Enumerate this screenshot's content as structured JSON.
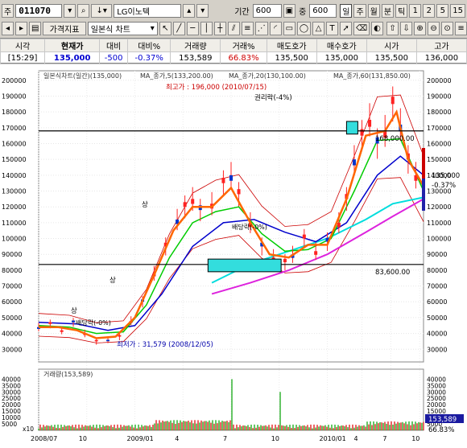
{
  "toolbar": {
    "market_label": "주",
    "code": "011070",
    "name": "LG이노텍",
    "period_label": "기간",
    "period_value": "600",
    "count_label": "중",
    "count_value": "600",
    "period_buttons": [
      "일",
      "주",
      "월",
      "분",
      "틱",
      "1",
      "2",
      "5",
      "15"
    ],
    "selected_period": "일",
    "indicator_button": "가격지표",
    "chart_type": "일본식 차트",
    "arrows": [
      "↑",
      "↓",
      "→"
    ]
  },
  "quote": {
    "headers": [
      "시각",
      "현재가",
      "대비",
      "대비%",
      "거래량",
      "거래%",
      "매도호가",
      "매수호가",
      "시가",
      "고가"
    ],
    "values": [
      "[15:29]",
      "135,000",
      "-500",
      "-0.37%",
      "153,589",
      "66.83%",
      "135,500",
      "135,000",
      "135,500",
      "136,000"
    ]
  },
  "colors": {
    "ma5": "#ff6600",
    "ma20": "#00cc00",
    "ma60": "#0000cc",
    "ma120": "#00dddd",
    "ma240": "#dd22dd",
    "bollinger": "#cc0000",
    "candle": "#ff2222",
    "volume_up": "#dd0000",
    "volume_down": "#00a000",
    "highlight": "#33dddd"
  },
  "chart_data": {
    "type": "line",
    "price_legend": "일본식차트(일간)(135,000)",
    "ma5_legend": "MA_종가,5(133,200.00)",
    "ma20_legend": "MA_종가,20(130,100.00)",
    "ma60_legend": "MA_종가,60(131,850.00)",
    "y_ticks": [
      30000,
      40000,
      50000,
      60000,
      70000,
      80000,
      90000,
      100000,
      110000,
      120000,
      130000,
      140000,
      150000,
      160000,
      170000,
      180000,
      190000,
      200000
    ],
    "ylim": [
      22000,
      206000
    ],
    "x_ticks": [
      "2008/07",
      "10",
      "2009/01",
      "4",
      "7",
      "10",
      "2010/01",
      "4",
      "7",
      "10"
    ],
    "x_tick_pos": [
      0,
      0.125,
      0.25,
      0.375,
      0.5,
      0.625,
      0.75,
      0.84,
      0.915,
      0.99
    ],
    "price_series": [
      [
        0,
        44000
      ],
      [
        0.03,
        46000
      ],
      [
        0.06,
        42000
      ],
      [
        0.09,
        47000
      ],
      [
        0.12,
        40000
      ],
      [
        0.15,
        35000
      ],
      [
        0.18,
        36000
      ],
      [
        0.21,
        38000
      ],
      [
        0.24,
        48000
      ],
      [
        0.27,
        60000
      ],
      [
        0.3,
        78000
      ],
      [
        0.33,
        95000
      ],
      [
        0.36,
        112000
      ],
      [
        0.38,
        120000
      ],
      [
        0.4,
        125000
      ],
      [
        0.42,
        118000
      ],
      [
        0.45,
        122000
      ],
      [
        0.48,
        135000
      ],
      [
        0.5,
        140000
      ],
      [
        0.52,
        128000
      ],
      [
        0.55,
        110000
      ],
      [
        0.58,
        95000
      ],
      [
        0.61,
        88000
      ],
      [
        0.64,
        85000
      ],
      [
        0.66,
        90000
      ],
      [
        0.69,
        100000
      ],
      [
        0.72,
        92000
      ],
      [
        0.75,
        98000
      ],
      [
        0.78,
        110000
      ],
      [
        0.8,
        125000
      ],
      [
        0.82,
        150000
      ],
      [
        0.84,
        165000
      ],
      [
        0.86,
        175000
      ],
      [
        0.88,
        160000
      ],
      [
        0.9,
        168000
      ],
      [
        0.92,
        185000
      ],
      [
        0.94,
        172000
      ],
      [
        0.96,
        150000
      ],
      [
        0.98,
        140000
      ],
      [
        1.0,
        132000
      ]
    ],
    "ma5": [
      [
        0,
        44000
      ],
      [
        0.05,
        44000
      ],
      [
        0.1,
        42000
      ],
      [
        0.15,
        37000
      ],
      [
        0.2,
        38000
      ],
      [
        0.25,
        50000
      ],
      [
        0.3,
        77000
      ],
      [
        0.35,
        105000
      ],
      [
        0.4,
        120000
      ],
      [
        0.45,
        120000
      ],
      [
        0.5,
        132000
      ],
      [
        0.55,
        110000
      ],
      [
        0.6,
        90000
      ],
      [
        0.65,
        88000
      ],
      [
        0.7,
        96000
      ],
      [
        0.75,
        96000
      ],
      [
        0.8,
        125000
      ],
      [
        0.85,
        165000
      ],
      [
        0.9,
        168000
      ],
      [
        0.93,
        180000
      ],
      [
        0.96,
        150000
      ],
      [
        1.0,
        133200
      ]
    ],
    "ma20": [
      [
        0,
        45000
      ],
      [
        0.08,
        44000
      ],
      [
        0.15,
        40000
      ],
      [
        0.22,
        41000
      ],
      [
        0.28,
        58000
      ],
      [
        0.34,
        88000
      ],
      [
        0.4,
        110000
      ],
      [
        0.46,
        117000
      ],
      [
        0.52,
        120000
      ],
      [
        0.58,
        103000
      ],
      [
        0.64,
        92000
      ],
      [
        0.7,
        93000
      ],
      [
        0.76,
        100000
      ],
      [
        0.82,
        130000
      ],
      [
        0.88,
        162000
      ],
      [
        0.94,
        163000
      ],
      [
        1.0,
        130100
      ]
    ],
    "ma60": [
      [
        0,
        47000
      ],
      [
        0.1,
        46000
      ],
      [
        0.18,
        42000
      ],
      [
        0.25,
        45000
      ],
      [
        0.32,
        65000
      ],
      [
        0.4,
        95000
      ],
      [
        0.48,
        110000
      ],
      [
        0.56,
        112000
      ],
      [
        0.64,
        104000
      ],
      [
        0.72,
        98000
      ],
      [
        0.8,
        110000
      ],
      [
        0.88,
        140000
      ],
      [
        0.94,
        152000
      ],
      [
        1.0,
        140000
      ]
    ],
    "ma120": [
      [
        0.45,
        72000
      ],
      [
        0.55,
        84000
      ],
      [
        0.65,
        92000
      ],
      [
        0.75,
        100000
      ],
      [
        0.85,
        112000
      ],
      [
        0.92,
        122000
      ],
      [
        1.0,
        126000
      ]
    ],
    "ma240": [
      [
        0.45,
        65000
      ],
      [
        0.55,
        72000
      ],
      [
        0.65,
        80000
      ],
      [
        0.75,
        90000
      ],
      [
        0.85,
        104000
      ],
      [
        0.92,
        114000
      ],
      [
        1.0,
        125000
      ]
    ],
    "annotations": {
      "high": "최고가 : 196,000 (2010/07/15)",
      "low": "최저가 : 31,579 (2008/12/05)",
      "rights": "권리락(-4%)",
      "small1": "배당락(-0%)",
      "small2": "배당락(-0%)",
      "sang1": "상",
      "sang2": "상",
      "sang3": "상"
    },
    "hlines": [
      {
        "value": 168000,
        "label": "168,000.00"
      },
      {
        "value": 83600,
        "label": "83,600.00"
      }
    ],
    "current_price": "135,000",
    "current_change": "-0.37%",
    "volume_label": "거래량(153,589)",
    "volume_value_box": "153,589",
    "volume_ratio": "66.83%",
    "volume_scale": "x10",
    "volume_ticks": [
      5000,
      10000,
      15000,
      20000,
      25000,
      30000,
      35000,
      40000
    ],
    "volume_ylim": [
      0,
      44000
    ]
  }
}
